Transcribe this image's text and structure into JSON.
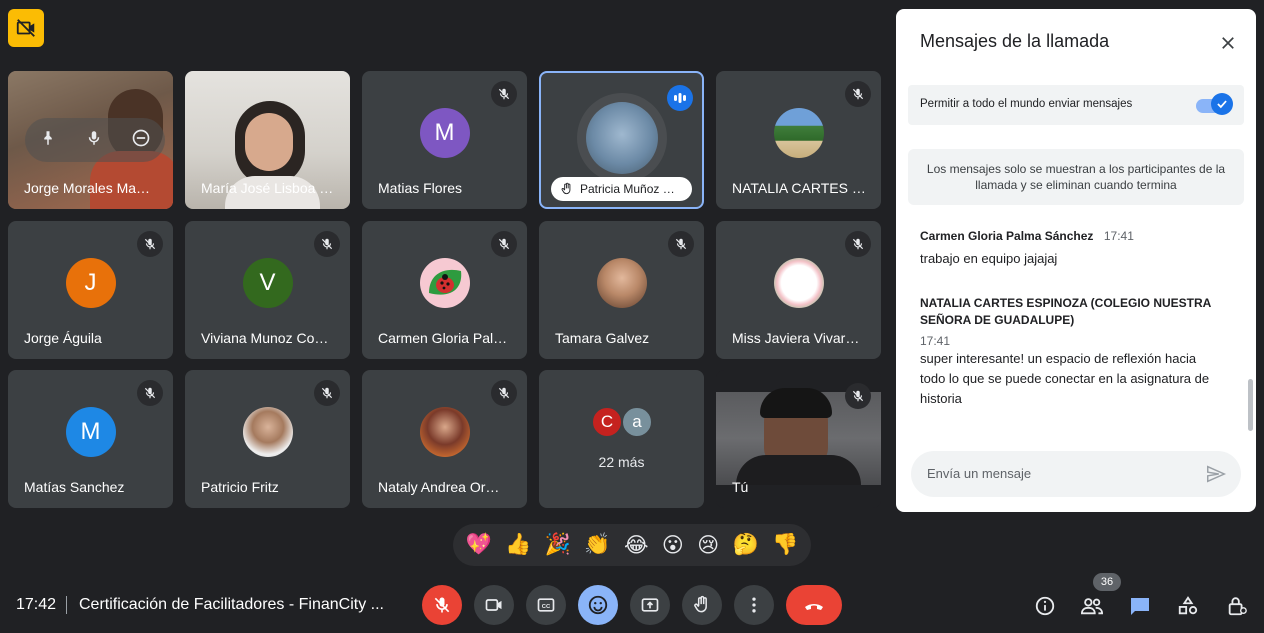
{
  "grid": {
    "tiles": [
      {
        "name": "Jorge Morales Ma…",
        "avatar": "",
        "avatar_color": "",
        "muted": false
      },
      {
        "name": "María José Lisboa …",
        "avatar": "",
        "avatar_color": "",
        "muted": false
      },
      {
        "name": "Matias Flores",
        "avatar": "M",
        "avatar_color": "#7e57c2",
        "muted": true
      },
      {
        "name": "Patricia Muñoz …",
        "avatar": "",
        "avatar_color": "",
        "muted": false,
        "speaking": true
      },
      {
        "name": "NATALIA CARTES …",
        "avatar": "",
        "avatar_color": "",
        "muted": true
      },
      {
        "name": "Jorge Águila",
        "avatar": "J",
        "avatar_color": "#e8710a",
        "muted": true
      },
      {
        "name": "Viviana Munoz Co…",
        "avatar": "V",
        "avatar_color": "#33691e",
        "muted": true
      },
      {
        "name": "Carmen Gloria Pal…",
        "avatar": "",
        "avatar_color": "",
        "muted": true
      },
      {
        "name": "Tamara Galvez",
        "avatar": "",
        "avatar_color": "",
        "muted": true
      },
      {
        "name": "Miss Javiera Vivar…",
        "avatar": "",
        "avatar_color": "",
        "muted": true
      },
      {
        "name": "Matías Sanchez",
        "avatar": "M",
        "avatar_color": "#1e88e5",
        "muted": true
      },
      {
        "name": "Patricio Fritz",
        "avatar": "",
        "avatar_color": "",
        "muted": true
      },
      {
        "name": "Nataly Andrea Or…",
        "avatar": "",
        "avatar_color": "",
        "muted": true
      },
      {
        "name": "22 más",
        "avatar": "",
        "avatar_color": "",
        "muted": false
      },
      {
        "name": "Tú",
        "avatar": "",
        "avatar_color": "",
        "muted": true
      }
    ],
    "more_avatars": [
      "C",
      "a"
    ]
  },
  "reactions": [
    "💖",
    "👍",
    "🎉",
    "👏",
    "😂",
    "😮",
    "😢",
    "🤔",
    "👎"
  ],
  "bottom_bar": {
    "time": "17:42",
    "meeting_title": "Certificación de Facilitadores - FinanCity ...",
    "participants_count": "36"
  },
  "chat": {
    "title": "Mensajes de la llamada",
    "allow_label": "Permitir a todo el mundo enviar mensajes",
    "allow_enabled": true,
    "info": "Los mensajes solo se muestran a los participantes de la llamada y se eliminan cuando termina",
    "messages": [
      {
        "author": "Carmen Gloria Palma Sánchez",
        "time": "17:41",
        "text": "trabajo en equipo jajajaj"
      },
      {
        "author": "NATALIA CARTES ESPINOZA (COLEGIO NUESTRA SEÑORA DE GUADALUPE)",
        "time": "17:41",
        "text": "super interesante! un espacio de reflexión hacia todo lo que se puede conectar en la asignatura de historia"
      }
    ],
    "input_placeholder": "Envía un mensaje"
  },
  "colors": {
    "accent": "#1a73e8",
    "end_call": "#ea4335",
    "background": "#202124",
    "tile": "#3c4043"
  }
}
